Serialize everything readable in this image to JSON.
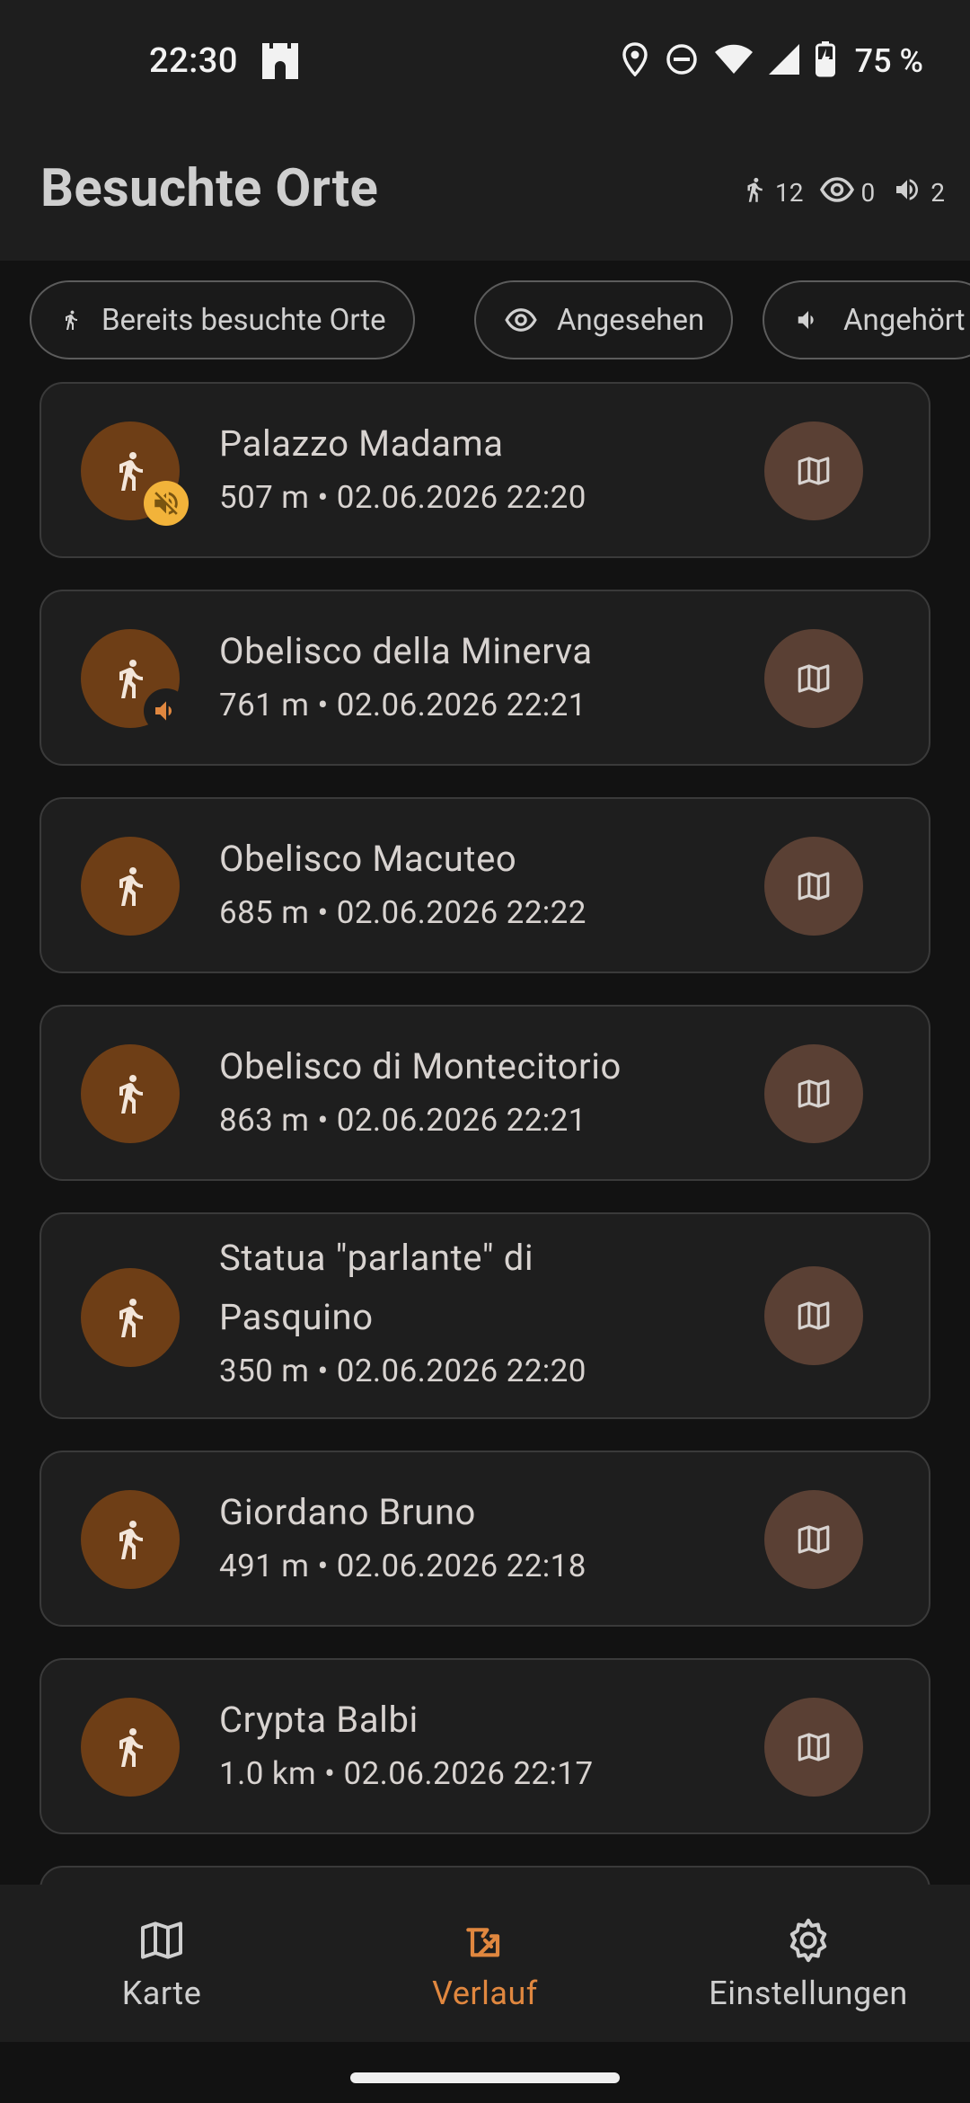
{
  "status_bar": {
    "time": "22:30",
    "battery_percent": "75 %",
    "icons": [
      "castle-icon",
      "location-icon",
      "dnd-icon",
      "wifi-icon",
      "signal-icon",
      "battery-charging-icon"
    ]
  },
  "header": {
    "title": "Besuchte Orte",
    "counts": {
      "visited": "12",
      "seen": "0",
      "heard": "2"
    }
  },
  "filters": [
    {
      "label": "Bereits besuchte Orte",
      "icon": "walk-icon"
    },
    {
      "label": "Angesehen",
      "icon": "eye-icon"
    },
    {
      "label": "Angehört",
      "icon": "speaker-icon"
    }
  ],
  "places": [
    {
      "name": "Palazzo Madama",
      "meta": "507 m • 02.06.2026 22:20",
      "badge": "muted"
    },
    {
      "name": "Obelisco della Minerva",
      "meta": "761 m • 02.06.2026 22:21",
      "badge": "sound"
    },
    {
      "name": "Obelisco Macuteo",
      "meta": "685 m • 02.06.2026 22:22",
      "badge": ""
    },
    {
      "name": "Obelisco di Montecitorio",
      "meta": "863 m • 02.06.2026 22:21",
      "badge": ""
    },
    {
      "name": "Statua \"parlante\" di Pasquino",
      "meta": "350 m • 02.06.2026 22:20",
      "badge": ""
    },
    {
      "name": "Giordano Bruno",
      "meta": "491 m • 02.06.2026 22:18",
      "badge": ""
    },
    {
      "name": "Crypta Balbi",
      "meta": "1.0 km • 02.06.2026 22:17",
      "badge": ""
    }
  ],
  "nav": [
    {
      "label": "Karte",
      "icon": "map-icon"
    },
    {
      "label": "Verlauf",
      "icon": "history-icon",
      "active": true
    },
    {
      "label": "Einstellungen",
      "icon": "gear-icon"
    }
  ],
  "colors": {
    "accent": "#e0873f",
    "avatar": "#6e3e16",
    "map_button": "#5a4034",
    "muted_badge": "#f2b33a"
  }
}
